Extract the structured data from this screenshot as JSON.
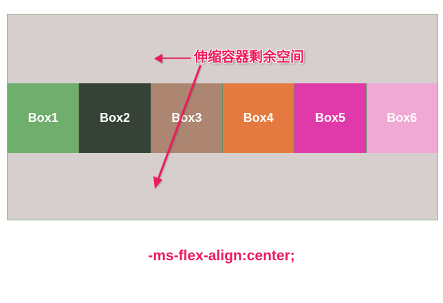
{
  "boxes": [
    {
      "label": "Box1",
      "color": "#6fae6d"
    },
    {
      "label": "Box2",
      "color": "#374237"
    },
    {
      "label": "Box3",
      "color": "#ad8672"
    },
    {
      "label": "Box4",
      "color": "#e57a40"
    },
    {
      "label": "Box5",
      "color": "#e03aaa"
    },
    {
      "label": "Box6",
      "color": "#efa9d4"
    }
  ],
  "annotation": {
    "text": "伸缩容器剩余空间",
    "color": "#ec1c5c"
  },
  "caption": {
    "text": "-ms-flex-align:center;"
  },
  "colors": {
    "container_bg": "#d6cfcd",
    "container_border": "#8fb58a",
    "marker": "#ec1c5c"
  }
}
